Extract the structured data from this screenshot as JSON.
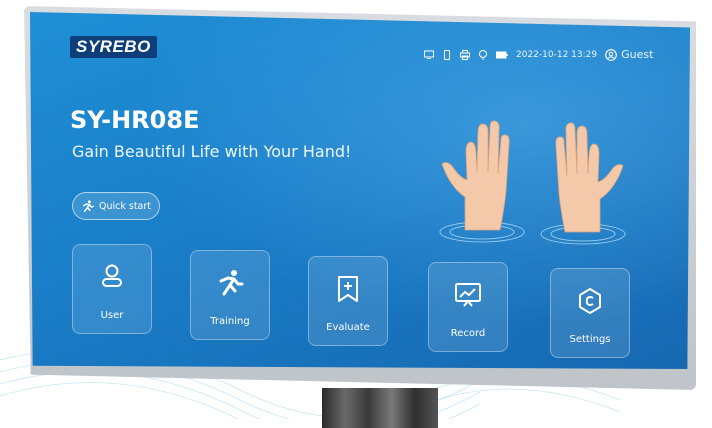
{
  "header": {
    "logo": "SYREBO",
    "datetime": "2022-10-12 13:29",
    "user": "Guest",
    "status_icons": [
      "screen-icon",
      "storage-icon",
      "printer-icon",
      "plug-icon",
      "battery-icon"
    ]
  },
  "hero": {
    "title": "SY-HR08E",
    "subtitle": "Gain Beautiful Life with Your Hand!",
    "quick_start": "Quick start"
  },
  "tiles": [
    {
      "label": "User",
      "icon": "user-icon"
    },
    {
      "label": "Training",
      "icon": "running-icon"
    },
    {
      "label": "Evaluate",
      "icon": "bookmark-plus-icon"
    },
    {
      "label": "Record",
      "icon": "chart-board-icon"
    },
    {
      "label": "Settings",
      "icon": "settings-icon"
    }
  ],
  "colors": {
    "screen": "#1a7ec8",
    "logo_bg": "#0e3e7a",
    "text": "#ffffff"
  }
}
